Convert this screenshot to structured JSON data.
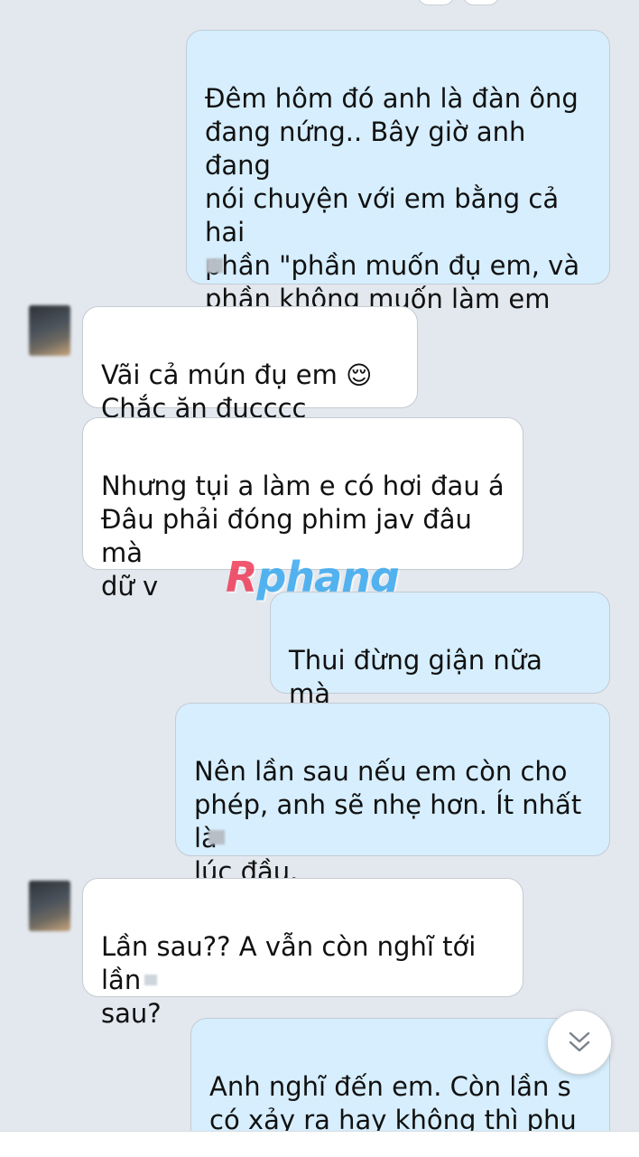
{
  "messages": [
    {
      "from": "me",
      "text": "Đêm hôm đó anh là đàn ông\nđang nứng.. Bây giờ anh đang\nnói chuyện với em bằng cả hai\nphần \"phần muốn đụ em, và\nphần không muốn làm em tổn\nthương hơn.",
      "emoji": "😢😢"
    },
    {
      "from": "them",
      "text": "Vãi cả mún đụ em",
      "emoji": "😌",
      "text2": "Chắc ăn đụcccc quaaaa"
    },
    {
      "from": "them",
      "text": "Nhưng tụi a làm e có hơi đau á\nĐâu phải đóng phim jav đâu mà\ndữ v"
    },
    {
      "from": "me",
      "text": "Thui đừng giận nữa mà\nA xin lỗi r"
    },
    {
      "from": "me",
      "text": "Nên lần sau nếu em còn cho\nphép, anh sẽ nhẹ hơn. Ít nhất là\nlúc đầu."
    },
    {
      "from": "them",
      "text": "Lần sau?? A vẫn còn nghĩ tới lần\nsau?"
    },
    {
      "from": "me",
      "text": "Anh nghĩ đến em. Còn lần s\ncó xảy ra hay không thì phụ\nthuộc vào em..."
    }
  ],
  "watermark": {
    "prefix": "R",
    "rest": "phang"
  },
  "colors": {
    "outgoing": "#d6eefd",
    "incoming": "#ffffff",
    "background": "#e3e8ee"
  },
  "icons": {
    "scroll_down": "chevron-double-down-icon"
  }
}
